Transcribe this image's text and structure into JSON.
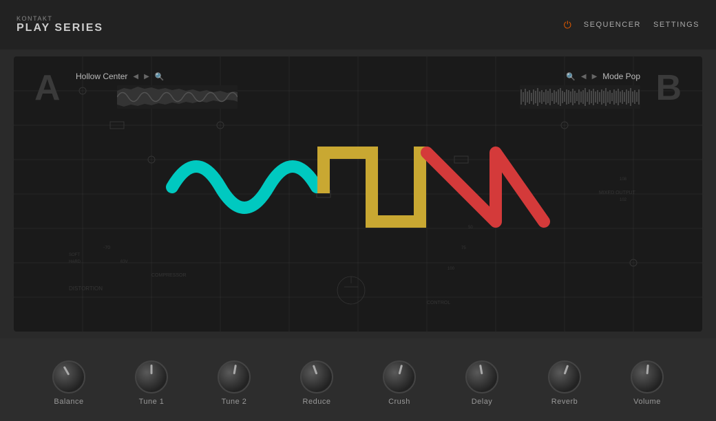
{
  "brand": {
    "kontakt": "KONTAKT",
    "play_series": "PLAY SERIES"
  },
  "top_nav": {
    "sequencer": "SEQUENCER",
    "settings": "SETTINGS"
  },
  "slot_a": {
    "label": "A",
    "name": "Hollow Center",
    "controls": "◀▶ 🔍"
  },
  "slot_b": {
    "label": "B",
    "name": "Mode Pop",
    "controls": "🔍 ◀▶"
  },
  "knobs": [
    {
      "id": "balance",
      "label": "Balance",
      "class": "balance"
    },
    {
      "id": "tune1",
      "label": "Tune 1",
      "class": "tune1"
    },
    {
      "id": "tune2",
      "label": "Tune 2",
      "class": "tune2"
    },
    {
      "id": "reduce",
      "label": "Reduce",
      "class": "reduce"
    },
    {
      "id": "crush",
      "label": "Crush",
      "class": "crush"
    },
    {
      "id": "delay",
      "label": "Delay",
      "class": "delay"
    },
    {
      "id": "reverb",
      "label": "Reverb",
      "class": "reverb"
    },
    {
      "id": "volume",
      "label": "Volume",
      "class": "volume"
    }
  ],
  "colors": {
    "sine_wave": "#00c9c0",
    "square_wave": "#c9a832",
    "sawtooth_wave": "#d43a3a",
    "background": "#1a1a1a",
    "top_bar": "#222222"
  }
}
